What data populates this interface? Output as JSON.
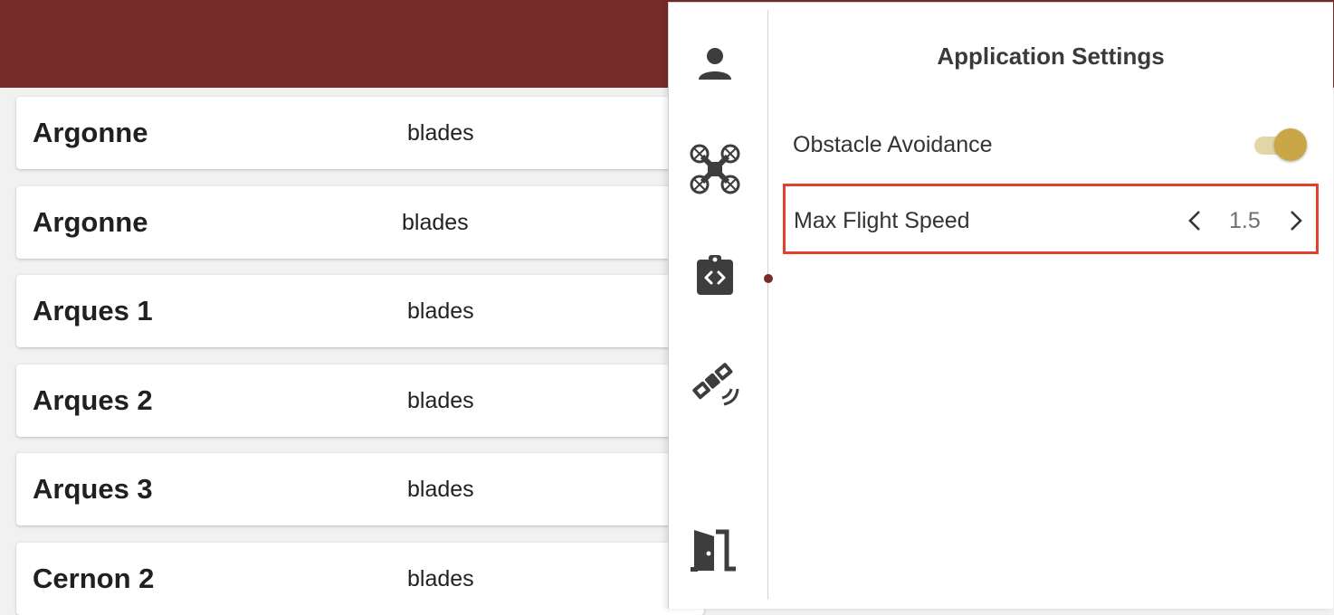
{
  "colors": {
    "brand": "#762c29",
    "accent": "#c9a646",
    "highlight": "#e4412d"
  },
  "list": {
    "items": [
      {
        "name": "Argonne",
        "type": "blades"
      },
      {
        "name": "Argonne",
        "type": "blades"
      },
      {
        "name": "Arques 1",
        "type": "blades"
      },
      {
        "name": "Arques 2",
        "type": "blades"
      },
      {
        "name": "Arques 3",
        "type": "blades"
      },
      {
        "name": "Cernon 2",
        "type": "blades"
      }
    ]
  },
  "settings_panel": {
    "title": "Application Settings",
    "rail_icons": [
      "person-icon",
      "drone-icon",
      "code-clipboard-icon",
      "satellite-icon",
      "exit-door-icon"
    ],
    "obstacle_avoidance": {
      "label": "Obstacle Avoidance",
      "enabled": true
    },
    "max_flight_speed": {
      "label": "Max Flight Speed",
      "value": "1.5"
    }
  }
}
